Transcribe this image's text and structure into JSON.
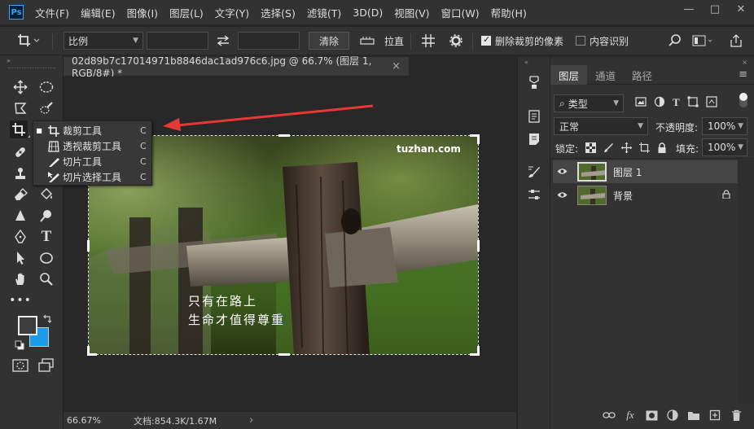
{
  "app": {
    "logo": "Ps",
    "menu": [
      "文件(F)",
      "编辑(E)",
      "图像(I)",
      "图层(L)",
      "文字(Y)",
      "选择(S)",
      "滤镜(T)",
      "3D(D)",
      "视图(V)",
      "窗口(W)",
      "帮助(H)"
    ],
    "window_controls": [
      "—",
      "□",
      "✕"
    ]
  },
  "options_bar": {
    "ratio_select": "比例",
    "clear_button": "清除",
    "straighten_label": "拉直",
    "delete_cropped_label": "删除裁剪的像素",
    "delete_cropped_checked": true,
    "content_aware_label": "内容识别",
    "content_aware_checked": false
  },
  "document": {
    "tab_title": "02d89b7c17014971b8846dac1ad976c6.jpg @ 66.7% (图层 1, RGB/8#) *",
    "tab_close": "×",
    "watermark": "tuzhan.com",
    "caption_line1": "只有在路上",
    "caption_line2": "生命才值得尊重"
  },
  "tool_flyout": {
    "items": [
      {
        "label": "裁剪工具",
        "shortcut": "C",
        "selected": true,
        "icon": "crop-icon"
      },
      {
        "label": "透视裁剪工具",
        "shortcut": "C",
        "selected": false,
        "icon": "perspective-crop-icon"
      },
      {
        "label": "切片工具",
        "shortcut": "C",
        "selected": false,
        "icon": "slice-icon"
      },
      {
        "label": "切片选择工具",
        "shortcut": "C",
        "selected": false,
        "icon": "slice-select-icon"
      }
    ]
  },
  "status_bar": {
    "zoom": "66.67%",
    "doc_info": "文档:854.3K/1.67M",
    "arrow": "›"
  },
  "layers_panel": {
    "tabs": [
      "图层",
      "通道",
      "路径"
    ],
    "active_tab": "图层",
    "filter_type": "类型",
    "blend_mode": "正常",
    "opacity_label": "不透明度:",
    "opacity_value": "100%",
    "lock_label": "锁定:",
    "fill_label": "填充:",
    "fill_value": "100%",
    "layers": [
      {
        "name": "图层 1",
        "selected": true,
        "locked": false
      },
      {
        "name": "背景",
        "selected": false,
        "locked": true
      }
    ]
  },
  "colors": {
    "accent": "#31a8ff",
    "background_swatch": "#1e9be8",
    "foreground_swatch": "#3c3c3c",
    "arrow": "#e53935"
  }
}
